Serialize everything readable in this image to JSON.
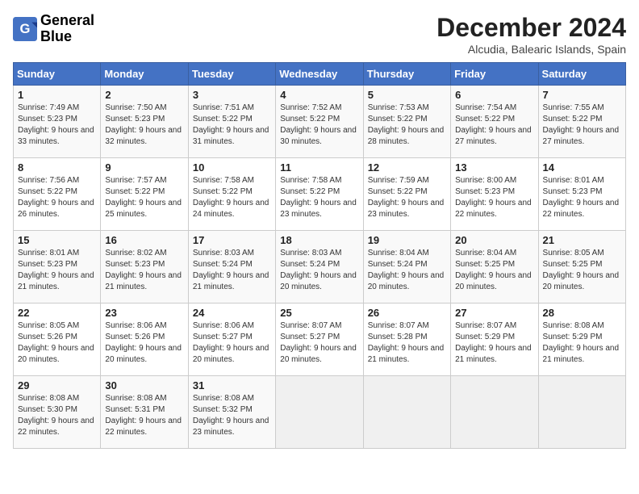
{
  "header": {
    "logo_line1": "General",
    "logo_line2": "Blue",
    "title": "December 2024",
    "subtitle": "Alcudia, Balearic Islands, Spain"
  },
  "days_of_week": [
    "Sunday",
    "Monday",
    "Tuesday",
    "Wednesday",
    "Thursday",
    "Friday",
    "Saturday"
  ],
  "weeks": [
    [
      {
        "day": 1,
        "sunrise": "7:49 AM",
        "sunset": "5:23 PM",
        "daylight": "9 hours and 33 minutes."
      },
      {
        "day": 2,
        "sunrise": "7:50 AM",
        "sunset": "5:23 PM",
        "daylight": "9 hours and 32 minutes."
      },
      {
        "day": 3,
        "sunrise": "7:51 AM",
        "sunset": "5:22 PM",
        "daylight": "9 hours and 31 minutes."
      },
      {
        "day": 4,
        "sunrise": "7:52 AM",
        "sunset": "5:22 PM",
        "daylight": "9 hours and 30 minutes."
      },
      {
        "day": 5,
        "sunrise": "7:53 AM",
        "sunset": "5:22 PM",
        "daylight": "9 hours and 28 minutes."
      },
      {
        "day": 6,
        "sunrise": "7:54 AM",
        "sunset": "5:22 PM",
        "daylight": "9 hours and 27 minutes."
      },
      {
        "day": 7,
        "sunrise": "7:55 AM",
        "sunset": "5:22 PM",
        "daylight": "9 hours and 27 minutes."
      }
    ],
    [
      {
        "day": 8,
        "sunrise": "7:56 AM",
        "sunset": "5:22 PM",
        "daylight": "9 hours and 26 minutes."
      },
      {
        "day": 9,
        "sunrise": "7:57 AM",
        "sunset": "5:22 PM",
        "daylight": "9 hours and 25 minutes."
      },
      {
        "day": 10,
        "sunrise": "7:58 AM",
        "sunset": "5:22 PM",
        "daylight": "9 hours and 24 minutes."
      },
      {
        "day": 11,
        "sunrise": "7:58 AM",
        "sunset": "5:22 PM",
        "daylight": "9 hours and 23 minutes."
      },
      {
        "day": 12,
        "sunrise": "7:59 AM",
        "sunset": "5:22 PM",
        "daylight": "9 hours and 23 minutes."
      },
      {
        "day": 13,
        "sunrise": "8:00 AM",
        "sunset": "5:23 PM",
        "daylight": "9 hours and 22 minutes."
      },
      {
        "day": 14,
        "sunrise": "8:01 AM",
        "sunset": "5:23 PM",
        "daylight": "9 hours and 22 minutes."
      }
    ],
    [
      {
        "day": 15,
        "sunrise": "8:01 AM",
        "sunset": "5:23 PM",
        "daylight": "9 hours and 21 minutes."
      },
      {
        "day": 16,
        "sunrise": "8:02 AM",
        "sunset": "5:23 PM",
        "daylight": "9 hours and 21 minutes."
      },
      {
        "day": 17,
        "sunrise": "8:03 AM",
        "sunset": "5:24 PM",
        "daylight": "9 hours and 21 minutes."
      },
      {
        "day": 18,
        "sunrise": "8:03 AM",
        "sunset": "5:24 PM",
        "daylight": "9 hours and 20 minutes."
      },
      {
        "day": 19,
        "sunrise": "8:04 AM",
        "sunset": "5:24 PM",
        "daylight": "9 hours and 20 minutes."
      },
      {
        "day": 20,
        "sunrise": "8:04 AM",
        "sunset": "5:25 PM",
        "daylight": "9 hours and 20 minutes."
      },
      {
        "day": 21,
        "sunrise": "8:05 AM",
        "sunset": "5:25 PM",
        "daylight": "9 hours and 20 minutes."
      }
    ],
    [
      {
        "day": 22,
        "sunrise": "8:05 AM",
        "sunset": "5:26 PM",
        "daylight": "9 hours and 20 minutes."
      },
      {
        "day": 23,
        "sunrise": "8:06 AM",
        "sunset": "5:26 PM",
        "daylight": "9 hours and 20 minutes."
      },
      {
        "day": 24,
        "sunrise": "8:06 AM",
        "sunset": "5:27 PM",
        "daylight": "9 hours and 20 minutes."
      },
      {
        "day": 25,
        "sunrise": "8:07 AM",
        "sunset": "5:27 PM",
        "daylight": "9 hours and 20 minutes."
      },
      {
        "day": 26,
        "sunrise": "8:07 AM",
        "sunset": "5:28 PM",
        "daylight": "9 hours and 21 minutes."
      },
      {
        "day": 27,
        "sunrise": "8:07 AM",
        "sunset": "5:29 PM",
        "daylight": "9 hours and 21 minutes."
      },
      {
        "day": 28,
        "sunrise": "8:08 AM",
        "sunset": "5:29 PM",
        "daylight": "9 hours and 21 minutes."
      }
    ],
    [
      {
        "day": 29,
        "sunrise": "8:08 AM",
        "sunset": "5:30 PM",
        "daylight": "9 hours and 22 minutes."
      },
      {
        "day": 30,
        "sunrise": "8:08 AM",
        "sunset": "5:31 PM",
        "daylight": "9 hours and 22 minutes."
      },
      {
        "day": 31,
        "sunrise": "8:08 AM",
        "sunset": "5:32 PM",
        "daylight": "9 hours and 23 minutes."
      },
      null,
      null,
      null,
      null
    ]
  ]
}
